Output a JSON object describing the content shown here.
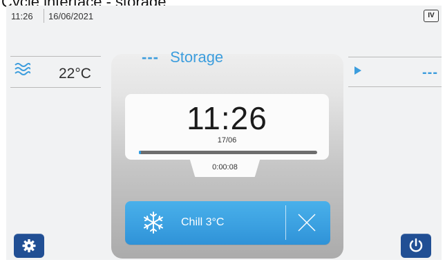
{
  "caption": {
    "text": "Cycle interface - storage"
  },
  "status_bar": {
    "time": "11:26",
    "date": "16/06/2021",
    "badge": "IV"
  },
  "ambient": {
    "icon": "heat-waves-icon",
    "value": "22°C"
  },
  "next_step": {
    "icon": "play-icon",
    "value": "---"
  },
  "program": {
    "dashes": "---",
    "title": "Storage"
  },
  "timer": {
    "time": "11:26",
    "date": "17/06",
    "progress_fraction": 0.01,
    "elapsed": "0:00:08"
  },
  "mode_button": {
    "icon": "snowflake-icon",
    "label": "Chill 3°C",
    "close_icon": "close-icon"
  },
  "controls": {
    "settings_icon": "gear-icon",
    "power_icon": "power-icon"
  },
  "colors": {
    "accent": "#3c9ddd",
    "button_blue": "#3a9fe0",
    "corner_button": "#214f94"
  }
}
